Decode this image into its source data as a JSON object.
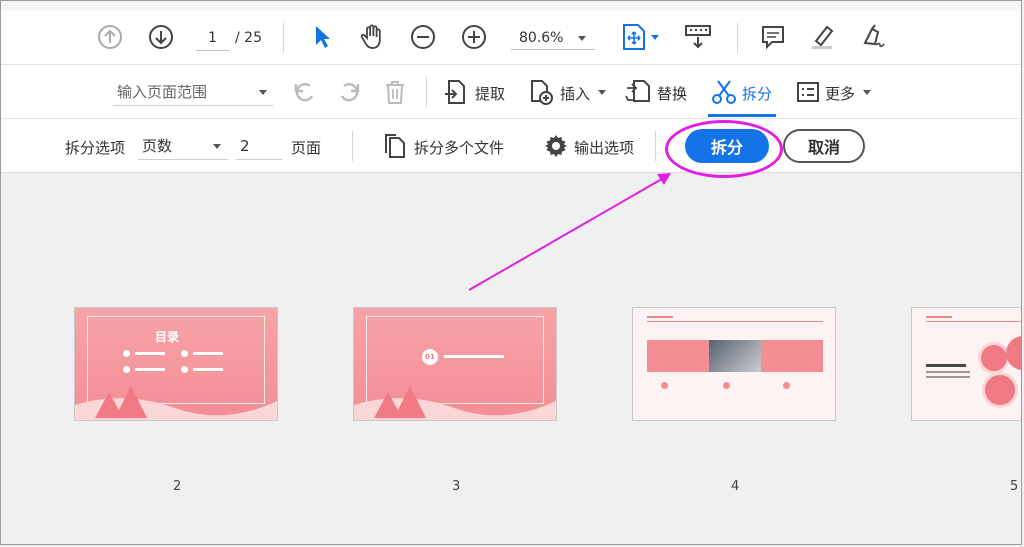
{
  "toolbar1": {
    "page_current": "1",
    "page_total": "/ 25",
    "zoom": "80.6%"
  },
  "toolbar2": {
    "range_placeholder": "输入页面范围",
    "extract": "提取",
    "insert": "插入",
    "replace": "替换",
    "split": "拆分",
    "more": "更多"
  },
  "toolbar3": {
    "split_options_label": "拆分选项",
    "split_mode": "页数",
    "pages_value": "2",
    "pages_label": "页面",
    "split_multiple_files": "拆分多个文件",
    "output_options": "输出选项",
    "split_button": "拆分",
    "cancel_button": "取消"
  },
  "thumbnails": [
    {
      "page": "2",
      "title": "目录"
    },
    {
      "page": "3",
      "badge": "01"
    },
    {
      "page": "4"
    },
    {
      "page": "5"
    }
  ],
  "colors": {
    "accent": "#1473e6",
    "annotation": "#e020e0",
    "slide_pink": "#f28e94"
  }
}
